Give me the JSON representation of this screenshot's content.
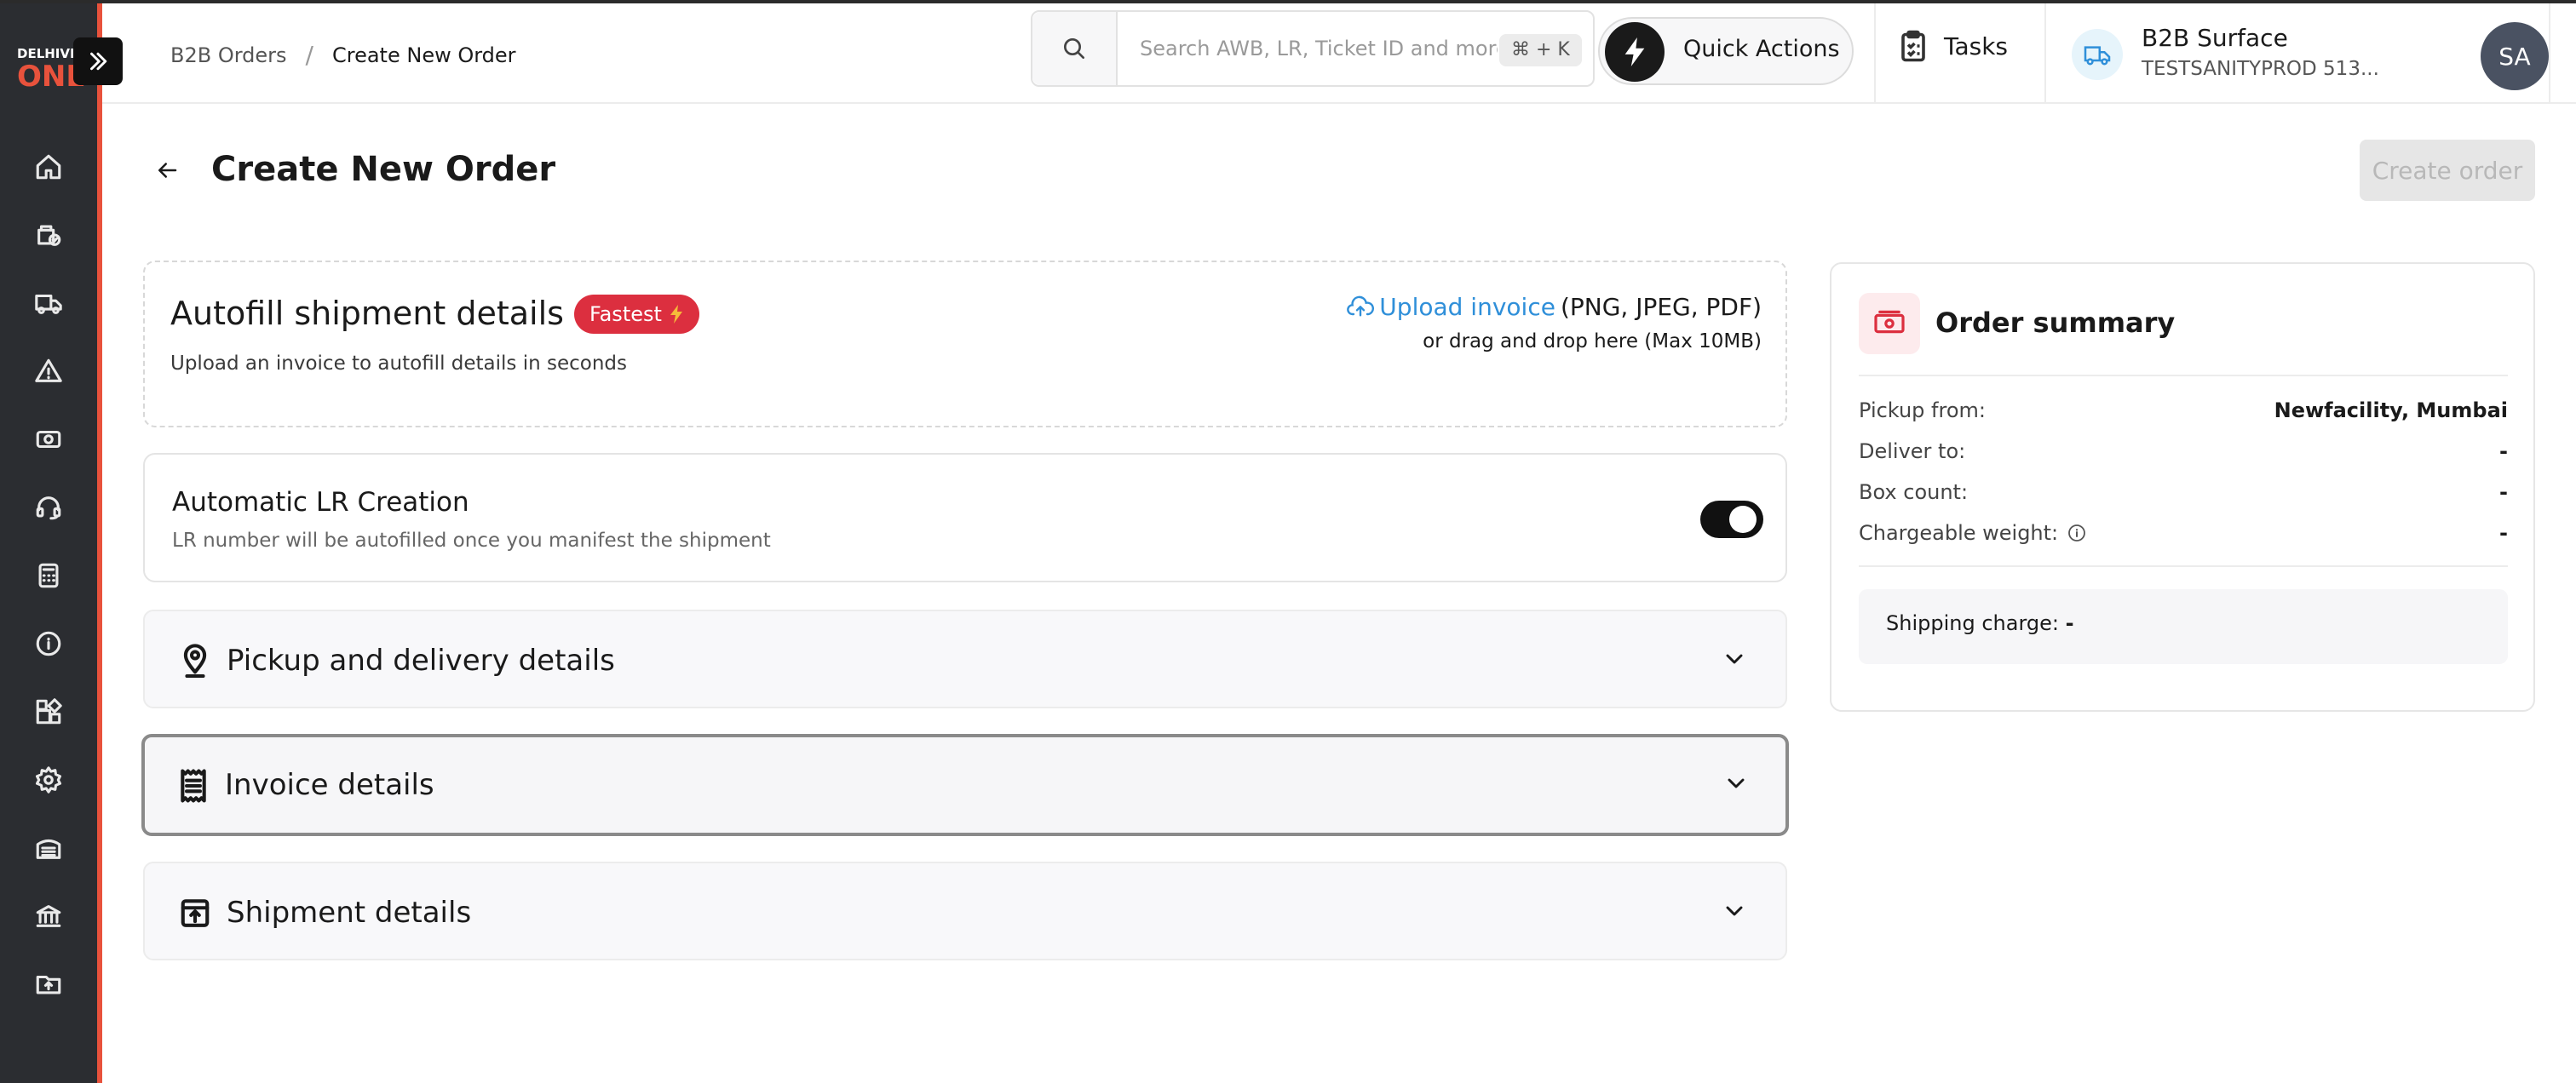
{
  "brand": {
    "logo_top": "DELHIVERY",
    "logo_bottom": "ONE",
    "accent": "#e8523c"
  },
  "breadcrumb": {
    "parent": "B2B Orders",
    "separator": "/",
    "current": "Create New Order"
  },
  "search": {
    "placeholder": "Search AWB, LR, Ticket ID and more...",
    "shortcut": "⌘ + K"
  },
  "header": {
    "quick_actions": "Quick Actions",
    "tasks": "Tasks",
    "account_title": "B2B Surface",
    "account_sub": "TESTSANITYPROD 513...",
    "avatar_initials": "SA"
  },
  "page": {
    "title": "Create New Order",
    "create_button": "Create order"
  },
  "autofill": {
    "title": "Autofill shipment details",
    "badge": "Fastest",
    "subtitle": "Upload an invoice to autofill details in seconds",
    "upload_link": "Upload invoice",
    "upload_types": "(PNG, JPEG, PDF)",
    "upload_sub": "or drag and drop here (Max 10MB)"
  },
  "lr": {
    "title": "Automatic LR Creation",
    "subtitle": "LR number will be autofilled once you manifest the shipment",
    "enabled": true
  },
  "sections": [
    {
      "label": "Pickup and delivery details",
      "icon": "location-pin-icon"
    },
    {
      "label": "Invoice details",
      "icon": "receipt-icon"
    },
    {
      "label": "Shipment details",
      "icon": "box-upload-icon"
    }
  ],
  "summary": {
    "title": "Order summary",
    "rows": [
      {
        "label": "Pickup from:",
        "value": "Newfacility, Mumbai"
      },
      {
        "label": "Deliver to:",
        "value": "-"
      },
      {
        "label": "Box count:",
        "value": "-"
      },
      {
        "label": "Chargeable weight:",
        "value": "-"
      }
    ],
    "shipping_label": "Shipping charge:",
    "shipping_value": "-"
  },
  "colors": {
    "badge": "#dc2f3f",
    "link": "#2f8fd9",
    "sidebar": "#2b2d31"
  }
}
